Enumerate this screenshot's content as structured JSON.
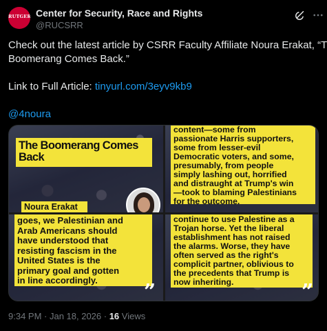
{
  "account": {
    "avatar_text": "RUTGERS",
    "name": "Center for Security, Race and Rights",
    "handle": "@RUCSRR"
  },
  "icons": {
    "grok": "grok-icon",
    "more": "more-icon"
  },
  "post": {
    "line1": "Check out the latest article by CSRR Faculty Affiliate Noura Erakat, “The",
    "line2": "Boomerang Comes Back.”",
    "link_prefix": "Link to Full Article: ",
    "link_text": "tinyurl.com/3eyv9kb9",
    "mention": "@4noura"
  },
  "media": {
    "panel1": {
      "title_line1": "The Boomerang Comes",
      "title_line2": "Back",
      "author": "Noura Erakat"
    },
    "panel2": {
      "lines": [
        "content—some from",
        "passionate Harris supporters,",
        "some from lesser-evil",
        "Democratic voters, and some,",
        "presumably, from people",
        "simply lashing out, horrified",
        "and distraught at Trump's win",
        "—took to blaming Palestinians",
        "for the outcome."
      ]
    },
    "panel3": {
      "lines": [
        "goes, we Palestinian and",
        "Arab Americans should",
        "have understood that",
        "resisting fascism in the",
        "United States is the",
        "primary goal and gotten",
        "in line accordingly."
      ]
    },
    "panel4": {
      "lines": [
        "continue to use Palestine as a",
        "Trojan horse. Yet the liberal",
        "establishment has not raised",
        "the alarms. Worse, they have",
        "often served as the right's",
        "complicit partner, oblivious to",
        "the precedents that Trump is",
        "now inheriting."
      ]
    },
    "quote_mark": "”",
    "colors": {
      "highlight": "#f3e33a",
      "link": "#1d9bf0"
    }
  },
  "footer": {
    "time": "9:34 PM · Jan 18, 2026 · ",
    "views_count": "16",
    "views_label": " Views"
  }
}
